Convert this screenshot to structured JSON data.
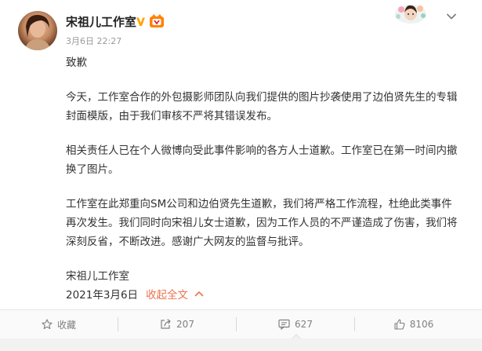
{
  "post": {
    "author": "宋祖儿工作室",
    "timestamp": "3月6日 22:27",
    "paragraphs": [
      "致歉",
      "今天，工作室合作的外包摄影师团队向我们提供的图片抄袭使用了边伯贤先生的专辑封面模版，由于我们审核不严将其错误发布。",
      "相关责任人已在个人微博向受此事件影响的各方人士道歉。工作室已在第一时间内撤换了图片。",
      "工作室在此郑重向SM公司和边伯贤先生道歉，我们将严格工作流程，杜绝此类事件再次发生。我们同时向宋祖儿女士道歉，因为工作人员的不严谨造成了伤害，我们将深刻反省，不断改进。感谢广大网友的监督与批评。",
      "宋祖儿工作室"
    ],
    "date": "2021年3月6日",
    "collapse_label": "收起全文"
  },
  "actions": {
    "favorite_label": "收藏",
    "repost_count": "207",
    "comment_count": "627",
    "like_count": "8106"
  },
  "colors": {
    "accent": "#eb7350",
    "verified": "#ffa500"
  },
  "icons": [
    "avatar",
    "verified-v-icon",
    "member-medal-icon",
    "decoration-sticker-icon",
    "chevron-down-icon",
    "chevron-up-icon",
    "star-icon",
    "repost-icon",
    "comment-icon",
    "like-icon"
  ]
}
